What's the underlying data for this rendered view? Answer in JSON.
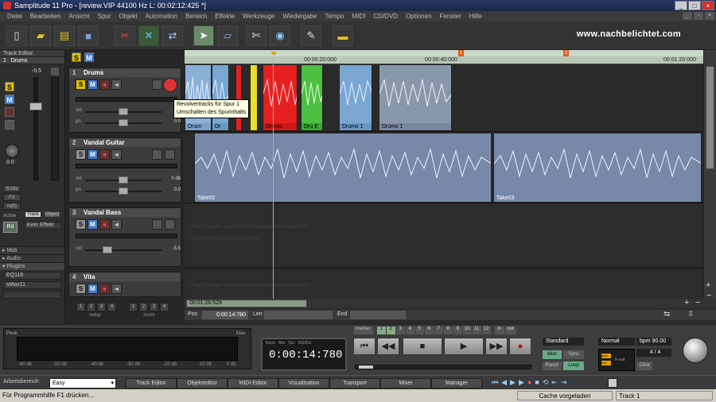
{
  "window": {
    "title": "Samplitude 11 Pro - [review.VIP   44100 Hz L: 00:02:12:425 *]"
  },
  "menu": [
    "Datei",
    "Bearbeiten",
    "Ansicht",
    "Spur",
    "Objekt",
    "Automation",
    "Bereich",
    "Effekte",
    "Werkzeuge",
    "Wiedergabe",
    "Tempo",
    "MIDI",
    "CD/DVD",
    "Optionen",
    "Fenster",
    "Hilfe"
  ],
  "watermark": "www.nachbelichtet.com",
  "track_editor": {
    "header": "Track Editor",
    "track_num": "1",
    "track_name": "Drums",
    "fader_value": "-0.5",
    "pan_value": "0.0",
    "tabs": [
      "Active",
      "Track",
      "Object"
    ],
    "kein_effekt": "Kein Effekt",
    "rd": "Rd",
    "sections": [
      "Midi",
      "Audio",
      "Plugins"
    ],
    "plugins": [
      "EQ116",
      "sMax11"
    ],
    "buttons": [
      "S.mix",
      "FX",
      "m(fi)"
    ]
  },
  "tracks": [
    {
      "num": "1",
      "name": "Drums",
      "vol": "-0.5",
      "pan": "0.0"
    },
    {
      "num": "2",
      "name": "Vandal Guitar",
      "vol": "0 db",
      "pan": "0.0"
    },
    {
      "num": "3",
      "name": "Vandal Bass",
      "vol": "-5.5",
      "pan": ""
    },
    {
      "num": "4",
      "name": "Vita",
      "vol": "",
      "pan": ""
    }
  ],
  "tooltip": [
    "Revolvertracks für Spur 1",
    "Umschalten des Spurinhalts"
  ],
  "bottom_buttons": {
    "setup_label": "setup",
    "zoom_label": "zoom",
    "setup_nums": [
      "1",
      "2",
      "3",
      "4"
    ],
    "zoom_nums": [
      "1",
      "2",
      "3",
      "4"
    ]
  },
  "ruler": {
    "t1": "00:00:20:000",
    "t2": "00:00:40:000",
    "t3": "00:01:20:000",
    "m1": "1",
    "m2": "2"
  },
  "clips": {
    "drums": [
      "Drum",
      "Dr",
      "Drums",
      "Dru E",
      "Drums 1",
      "Drums 1"
    ],
    "guitar": [
      "Take02",
      "Take03"
    ]
  },
  "lane_hints": [
    "Play-Cursor- und Bereichsmanipulationsbereich",
    "Objekt-Manipulationsbereich",
    "Play-Cursor- und Bereichsmanipulationsbereich"
  ],
  "scroll_time": "00:01:26:529",
  "position": {
    "pos_label": "Pos",
    "pos_value": "0:00:14:780",
    "len_label": "Len",
    "end_label": "End"
  },
  "transport": {
    "time": "0:00:14:780",
    "time_headers": [
      "Norm",
      "Min",
      "Sec",
      "MS/Dst"
    ],
    "marker_label": "marker",
    "markers": [
      "1",
      "2",
      "3",
      "4",
      "5",
      "6",
      "7",
      "8",
      "9",
      "10",
      "11",
      "12"
    ],
    "in_label": "in",
    "out_label": "out",
    "peak": "Peak",
    "max": "Max",
    "meter_scale": [
      "-60 db",
      "-50 db",
      "-40 db",
      "-30 db",
      "-20 db",
      "-10 db",
      "0 db"
    ],
    "mode": "Standard",
    "normal": "Normal",
    "bpm": "bpm 90.00",
    "sig": "4 / 4",
    "click": "Click",
    "mon": "Mon",
    "sync": "Sync",
    "punch": "Punch",
    "loop": "Loop",
    "in_out": "in  out",
    "mon_labels": [
      "gmix",
      "bus"
    ]
  },
  "bottom_tabs": {
    "area_label": "Arbeitsbereich",
    "area_value": "Easy",
    "tabs": [
      "Track Editor",
      "Objekteditor",
      "MIDI Editor",
      "Visualisation",
      "Transport",
      "Mixer",
      "Manager"
    ]
  },
  "status": {
    "help": "Für Programmhilfe F1 drücken...",
    "cache": "Cache vorgeladen",
    "track": "Track 1"
  },
  "colors": {
    "accent_green": "#6fc24a",
    "accent_red": "#e42020",
    "clip_blue": "#7fa6d8",
    "clip_yellow": "#e8e020"
  }
}
